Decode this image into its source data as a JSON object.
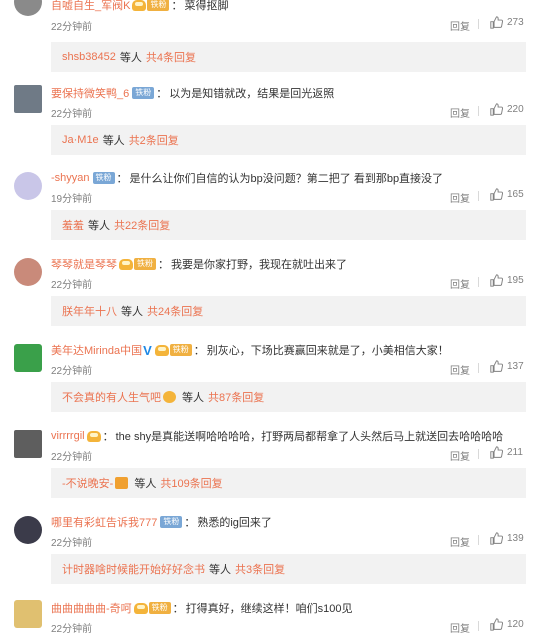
{
  "comments": [
    {
      "username": "自嘘自生_军阀K",
      "badge_text": "铁粉",
      "badge_type": "crown",
      "verified": false,
      "text": "菜得抠脚",
      "time": "22分钟前",
      "reply_label": "回复",
      "likes": "273",
      "sub_names": "shsb38452",
      "sub_mid": "等人",
      "sub_count": "共4条回复",
      "avatar_color": "#8a8a8a"
    },
    {
      "username": "要保持微笑鸭_6",
      "badge_text": "铁粉",
      "badge_type": "plain",
      "verified": false,
      "text": "以为是知错就改，结果是回光返照",
      "time": "22分钟前",
      "reply_label": "回复",
      "likes": "220",
      "sub_names": "Ja·M1e",
      "sub_mid": "等人",
      "sub_count": "共2条回复",
      "avatar_color": "#6f7a86"
    },
    {
      "username": "-shyyan",
      "badge_text": "铁粉",
      "badge_type": "plain",
      "verified": false,
      "text": "是什么让你们自信的认为bp没问题？第二把了 看到那bp直接没了",
      "time": "19分钟前",
      "reply_label": "回复",
      "likes": "165",
      "sub_names": "羞羞",
      "sub_mid": "等人",
      "sub_count": "共22条回复",
      "avatar_color": "#c9c6e8"
    },
    {
      "username": "琴琴就是琴琴",
      "badge_text": "铁粉",
      "badge_type": "crown",
      "verified": false,
      "text": "我要是你家打野，我现在就吐出来了",
      "time": "22分钟前",
      "reply_label": "回复",
      "likes": "195",
      "sub_names": "朕年年十八",
      "sub_mid": "等人",
      "sub_count": "共24条回复",
      "avatar_color": "#c98a7a"
    },
    {
      "username": "美年达Mirinda中国",
      "badge_text": "铁粉",
      "badge_type": "crown",
      "verified": true,
      "text": "别灰心，下场比赛赢回来就是了，小美相信大家！",
      "time": "22分钟前",
      "reply_label": "回复",
      "likes": "137",
      "sub_names": "不会真的有人生气吧",
      "sub_mid": "等人",
      "sub_count": "共87条回复",
      "avatar_color": "#3aa04a"
    },
    {
      "username": "virrrrgil",
      "badge_text": "",
      "badge_type": "crown-only",
      "verified": false,
      "text": "the shy是真能送啊哈哈哈哈，打野两局都帮拿了人头然后马上就送回去哈哈哈哈",
      "time": "22分钟前",
      "reply_label": "回复",
      "likes": "211",
      "sub_names": "-不说晚安-",
      "sub_mid": "等人",
      "sub_count": "共109条回复",
      "avatar_color": "#5e5e5e"
    },
    {
      "username": "哪里有彩虹告诉我777",
      "badge_text": "铁粉",
      "badge_type": "plain",
      "verified": false,
      "text": "熟悉的ig回来了",
      "time": "22分钟前",
      "reply_label": "回复",
      "likes": "139",
      "sub_names": "计时器啥时候能开始好好念书",
      "sub_mid": "等人",
      "sub_count": "共3条回复",
      "avatar_color": "#3b3b4a"
    },
    {
      "username": "曲曲曲曲曲-奇呵",
      "badge_text": "铁粉",
      "badge_type": "crown",
      "verified": false,
      "text": "打得真好，继续这样！咱们s100见",
      "time": "22分钟前",
      "reply_label": "回复",
      "likes": "120",
      "sub_names": "",
      "sub_mid": "",
      "sub_count": "",
      "avatar_color": "#e0c070"
    }
  ],
  "colors": {
    "username": "#eb7350",
    "meta": "#808080",
    "subbox_bg": "#f2f2f2",
    "badge_gold": "#f0b041",
    "badge_blue": "#7aa7d6",
    "verified": "#1e88e5"
  },
  "icons": {
    "like": "thumbs-up-icon",
    "badge": "crown-badge-icon",
    "verified": "verified-v-icon"
  }
}
